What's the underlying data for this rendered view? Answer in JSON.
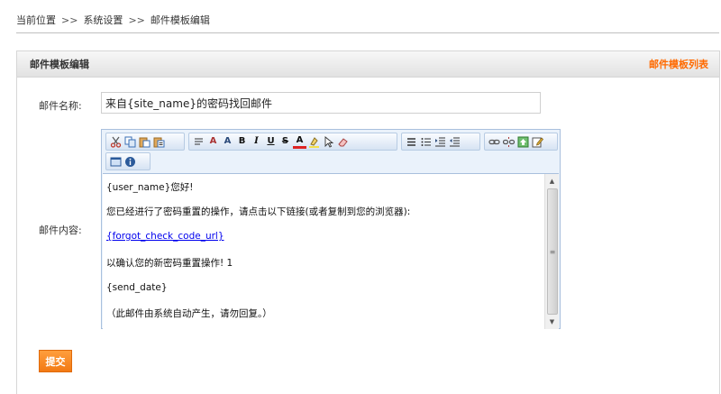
{
  "breadcrumb": {
    "items": [
      "当前位置",
      "系统设置",
      "邮件模板编辑"
    ],
    "separator": ">>"
  },
  "panel": {
    "title": "邮件模板编辑",
    "list_link": "邮件模板列表"
  },
  "form": {
    "name_label": "邮件名称:",
    "name_value": "来自{site_name}的密码找回邮件",
    "content_label": "邮件内容:"
  },
  "editor": {
    "toolbar_icons": [
      "cut-icon",
      "copy-icon",
      "paste-icon",
      "paste-text-icon",
      "format-icon",
      "font-name-icon",
      "font-size-icon",
      "bold-icon",
      "italic-icon",
      "underline-icon",
      "strikethrough-icon",
      "font-color-icon",
      "highlight-color-icon",
      "select-icon",
      "eraser-icon",
      "ordered-list-icon",
      "unordered-list-icon",
      "indent-icon",
      "outdent-icon",
      "link-icon",
      "unlink-icon",
      "image-icon",
      "edit-icon",
      "fullscreen-icon",
      "about-icon"
    ],
    "content": {
      "line1": "{user_name}您好!",
      "line2": "您已经进行了密码重置的操作，请点击以下链接(或者复制到您的浏览器):",
      "link": "{forgot_check_code_url}",
      "line4": "以确认您的新密码重置操作! 1",
      "line5": "{send_date}",
      "line6": "（此邮件由系统自动产生，请勿回复。）"
    }
  },
  "submit_label": "提交",
  "colors": {
    "accent": "#ff6a00",
    "submit": "#f58a1f",
    "editor_border": "#a9c0dd",
    "link": "#0000ee"
  }
}
